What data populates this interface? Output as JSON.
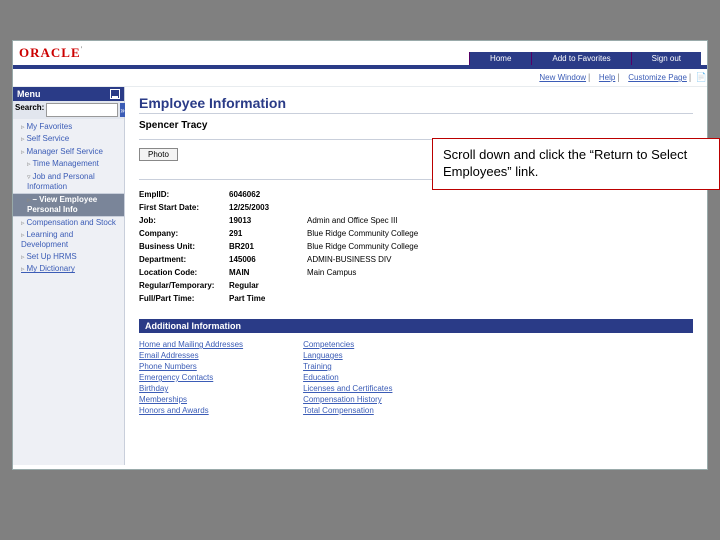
{
  "brand": {
    "name": "ORACLE",
    "sub": "'"
  },
  "topnav": [
    "Home",
    "Add to Favorites",
    "Sign out"
  ],
  "util_links": [
    "New Window",
    "Help",
    "Customize Page"
  ],
  "sidebar": {
    "menu_label": "Menu",
    "search_label": "Search:",
    "items": [
      {
        "label": "My Favorites"
      },
      {
        "label": "Self Service"
      },
      {
        "label": "Manager Self Service"
      },
      {
        "label": "Time Management",
        "indent": 1
      },
      {
        "label": "Job and Personal Information",
        "indent": 1,
        "open": true
      },
      {
        "label": "View Employee Personal Info",
        "indent": 1,
        "selected": true
      },
      {
        "label": "Compensation and Stock"
      },
      {
        "label": "Learning and Development"
      },
      {
        "label": "Set Up HRMS"
      },
      {
        "label": "My Dictionary",
        "link": true
      }
    ]
  },
  "page": {
    "title": "Employee Information",
    "employee_name": "Spencer Tracy",
    "photo_btn": "Photo"
  },
  "fields": [
    {
      "label": "EmplID:",
      "value": "6046062"
    },
    {
      "label": "First Start Date:",
      "value": "12/25/2003"
    },
    {
      "label": "Job:",
      "value": "19013",
      "desc": "Admin and Office Spec III"
    },
    {
      "label": "Company:",
      "value": "291",
      "desc": "Blue Ridge Community College"
    },
    {
      "label": "Business Unit:",
      "value": "BR201",
      "desc": "Blue Ridge Community College"
    },
    {
      "label": "Department:",
      "value": "145006",
      "desc": "ADMIN-BUSINESS DIV"
    },
    {
      "label": "Location Code:",
      "value": "MAIN",
      "desc": "Main Campus"
    },
    {
      "label": "Regular/Temporary:",
      "value": "Regular"
    },
    {
      "label": "Full/Part Time:",
      "value": "Part Time"
    }
  ],
  "section_additional": "Additional Information",
  "links_col1": [
    "Home and Mailing Addresses",
    "Email Addresses",
    "Phone Numbers",
    "Emergency Contacts",
    "Birthday",
    "Memberships",
    "Honors and Awards"
  ],
  "links_col2": [
    "Competencies",
    "Languages",
    "Training",
    "Education",
    "Licenses and Certificates",
    "Compensation History",
    "Total Compensation"
  ],
  "callout": "Scroll down and click the “Return to Select Employees” link."
}
